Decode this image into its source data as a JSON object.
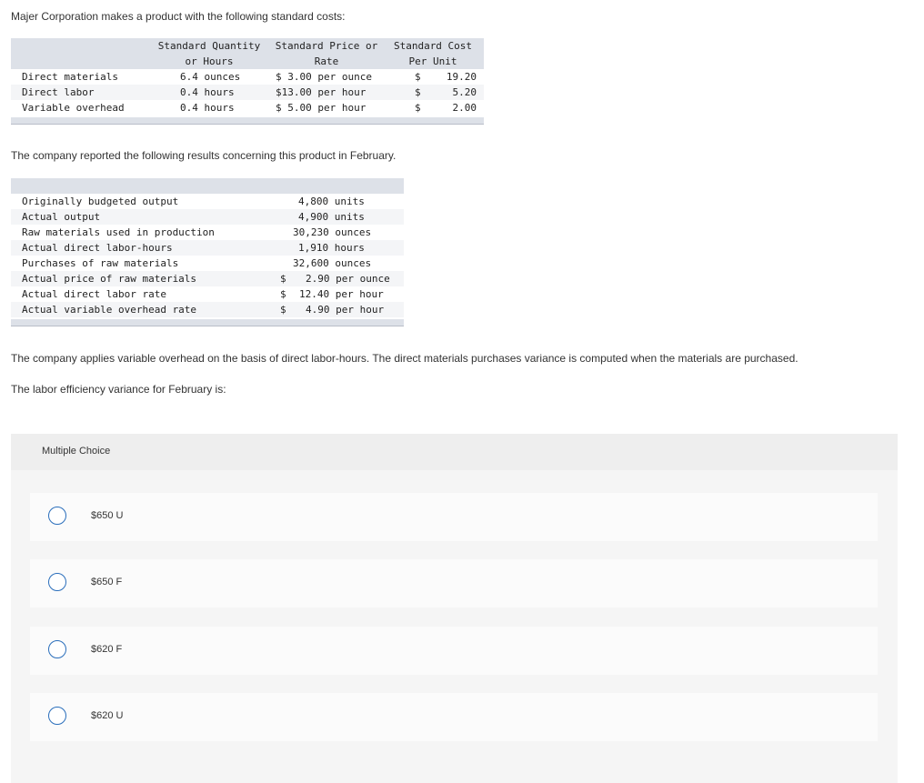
{
  "question": {
    "intro": "Majer Corporation makes a product with the following standard costs:",
    "results_intro": "The company reported the following results concerning this product in February.",
    "basis_note": "The company applies variable overhead on the basis of direct labor-hours. The direct materials purchases variance is computed when the materials are purchased.",
    "prompt": "The labor efficiency variance for February is:"
  },
  "standard_costs": {
    "headers": {
      "qty_line1": "Standard Quantity",
      "qty_line2": "or Hours",
      "price_line1": "Standard Price or",
      "price_line2": "Rate",
      "cost_line1": "Standard Cost",
      "cost_line2": "Per Unit"
    },
    "rows": [
      {
        "label": "Direct materials",
        "qty": "6.4 ounces",
        "price": "$ 3.00 per ounce",
        "cur": "$",
        "cost": "19.20"
      },
      {
        "label": "Direct labor",
        "qty": "0.4 hours",
        "price": "$13.00 per hour",
        "cur": "$",
        "cost": "5.20"
      },
      {
        "label": "Variable overhead",
        "qty": "0.4 hours",
        "price": "$ 5.00 per hour",
        "cur": "$",
        "cost": "2.00"
      }
    ]
  },
  "february_results": {
    "rows": [
      {
        "label": "Originally budgeted output",
        "cur": "",
        "value": "4,800 units"
      },
      {
        "label": "Actual output",
        "cur": "",
        "value": "4,900 units"
      },
      {
        "label": "Raw materials used in production",
        "cur": "",
        "value": "30,230 ounces"
      },
      {
        "label": "Actual direct labor-hours",
        "cur": "",
        "value": "1,910 hours"
      },
      {
        "label": "Purchases of raw materials",
        "cur": "",
        "value": "32,600 ounces"
      },
      {
        "label": "Actual price of raw materials",
        "cur": "$",
        "value": "2.90 per ounce"
      },
      {
        "label": "Actual direct labor rate",
        "cur": "$",
        "value": "12.40 per hour"
      },
      {
        "label": "Actual variable overhead rate",
        "cur": "$",
        "value": "4.90 per hour"
      }
    ]
  },
  "multiple_choice": {
    "title": "Multiple Choice",
    "options": [
      {
        "label": "$650 U"
      },
      {
        "label": "$650 F"
      },
      {
        "label": "$620 F"
      },
      {
        "label": "$620 U"
      }
    ]
  },
  "colors": {
    "table_header": "#dde1e8",
    "radio_border": "#2a6ebb",
    "panel_bg": "#f5f5f5"
  }
}
